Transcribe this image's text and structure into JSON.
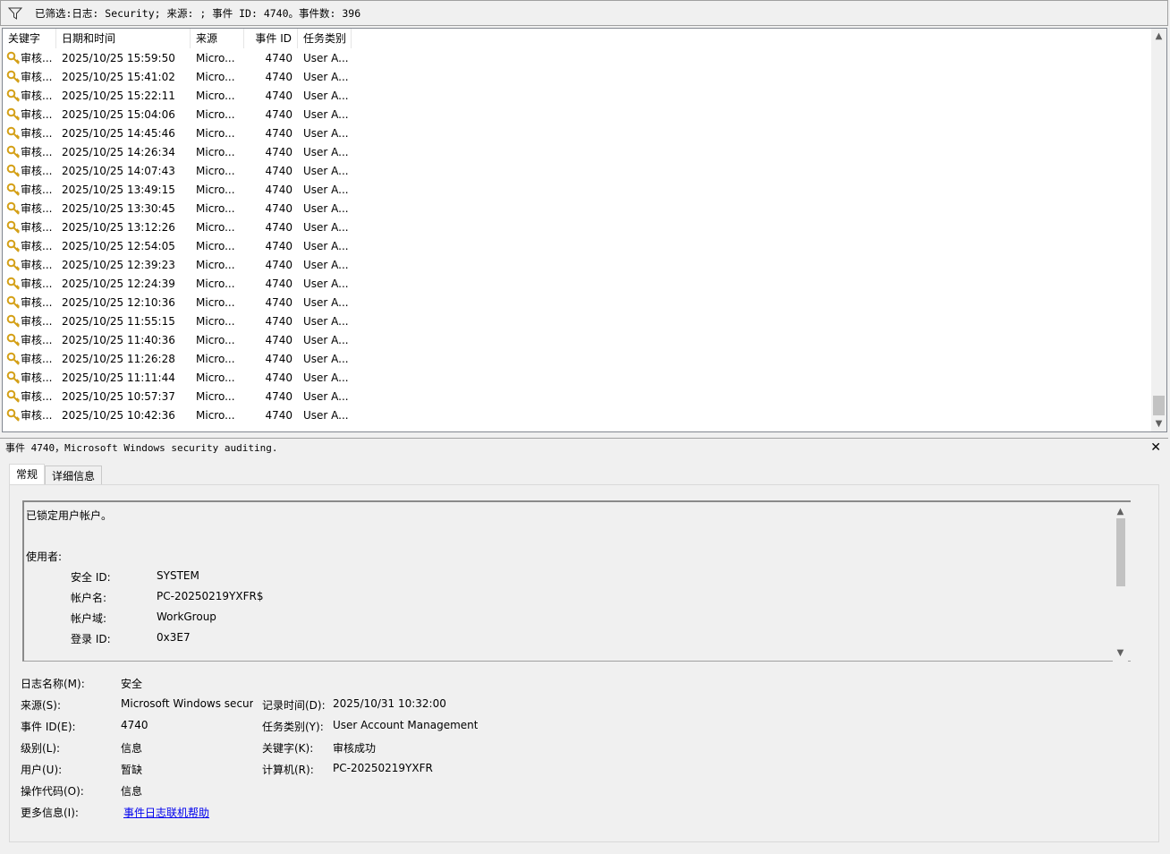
{
  "filter": {
    "text": "已筛选:日志: Security; 来源: ; 事件 ID: 4740。事件数: 396"
  },
  "columns": [
    "关键字",
    "日期和时间",
    "来源",
    "事件 ID",
    "任务类别"
  ],
  "rows": [
    {
      "keyword": "审核...",
      "date": "2025/10/25 15:59:50",
      "source": "Micro...",
      "id": "4740",
      "task": "User A..."
    },
    {
      "keyword": "审核...",
      "date": "2025/10/25 15:41:02",
      "source": "Micro...",
      "id": "4740",
      "task": "User A..."
    },
    {
      "keyword": "审核...",
      "date": "2025/10/25 15:22:11",
      "source": "Micro...",
      "id": "4740",
      "task": "User A..."
    },
    {
      "keyword": "审核...",
      "date": "2025/10/25 15:04:06",
      "source": "Micro...",
      "id": "4740",
      "task": "User A..."
    },
    {
      "keyword": "审核...",
      "date": "2025/10/25 14:45:46",
      "source": "Micro...",
      "id": "4740",
      "task": "User A..."
    },
    {
      "keyword": "审核...",
      "date": "2025/10/25 14:26:34",
      "source": "Micro...",
      "id": "4740",
      "task": "User A..."
    },
    {
      "keyword": "审核...",
      "date": "2025/10/25 14:07:43",
      "source": "Micro...",
      "id": "4740",
      "task": "User A..."
    },
    {
      "keyword": "审核...",
      "date": "2025/10/25 13:49:15",
      "source": "Micro...",
      "id": "4740",
      "task": "User A..."
    },
    {
      "keyword": "审核...",
      "date": "2025/10/25 13:30:45",
      "source": "Micro...",
      "id": "4740",
      "task": "User A..."
    },
    {
      "keyword": "审核...",
      "date": "2025/10/25 13:12:26",
      "source": "Micro...",
      "id": "4740",
      "task": "User A..."
    },
    {
      "keyword": "审核...",
      "date": "2025/10/25 12:54:05",
      "source": "Micro...",
      "id": "4740",
      "task": "User A..."
    },
    {
      "keyword": "审核...",
      "date": "2025/10/25 12:39:23",
      "source": "Micro...",
      "id": "4740",
      "task": "User A..."
    },
    {
      "keyword": "审核...",
      "date": "2025/10/25 12:24:39",
      "source": "Micro...",
      "id": "4740",
      "task": "User A..."
    },
    {
      "keyword": "审核...",
      "date": "2025/10/25 12:10:36",
      "source": "Micro...",
      "id": "4740",
      "task": "User A..."
    },
    {
      "keyword": "审核...",
      "date": "2025/10/25 11:55:15",
      "source": "Micro...",
      "id": "4740",
      "task": "User A..."
    },
    {
      "keyword": "审核...",
      "date": "2025/10/25 11:40:36",
      "source": "Micro...",
      "id": "4740",
      "task": "User A..."
    },
    {
      "keyword": "审核...",
      "date": "2025/10/25 11:26:28",
      "source": "Micro...",
      "id": "4740",
      "task": "User A..."
    },
    {
      "keyword": "审核...",
      "date": "2025/10/25 11:11:44",
      "source": "Micro...",
      "id": "4740",
      "task": "User A..."
    },
    {
      "keyword": "审核...",
      "date": "2025/10/25 10:57:37",
      "source": "Micro...",
      "id": "4740",
      "task": "User A..."
    },
    {
      "keyword": "审核...",
      "date": "2025/10/25 10:42:36",
      "source": "Micro...",
      "id": "4740",
      "task": "User A..."
    }
  ],
  "detail": {
    "title": "事件 4740，Microsoft Windows security auditing.",
    "close_glyph": "✕",
    "tabs": [
      "常规",
      "详细信息"
    ],
    "description": {
      "heading": "已锁定用户帐户。",
      "subject_label": "使用者:",
      "fields": [
        {
          "k": "安全 ID:",
          "v": "SYSTEM"
        },
        {
          "k": "帐户名:",
          "v": "PC-20250219YXFR$"
        },
        {
          "k": "帐户域:",
          "v": "WorkGroup"
        },
        {
          "k": "登录 ID:",
          "v": "0x3E7"
        }
      ]
    },
    "props": {
      "log_name_label": "日志名称(M):",
      "log_name": "安全",
      "source_label": "来源(S):",
      "source": "Microsoft Windows securi",
      "logged_label": "记录时间(D):",
      "logged": "2025/10/31 10:32:00",
      "event_id_label": "事件 ID(E):",
      "event_id": "4740",
      "task_label": "任务类别(Y):",
      "task": "User Account Management",
      "level_label": "级别(L):",
      "level": "信息",
      "keywords_label": "关键字(K):",
      "keywords": "审核成功",
      "user_label": "用户(U):",
      "user": "暂缺",
      "computer_label": "计算机(R):",
      "computer": "PC-20250219YXFR",
      "opcode_label": "操作代码(O):",
      "opcode": "信息",
      "more_label": "更多信息(I):",
      "more_link": "事件日志联机帮助"
    }
  },
  "colors": {
    "key_icon": "#d4a017",
    "link": "#0000ee"
  }
}
